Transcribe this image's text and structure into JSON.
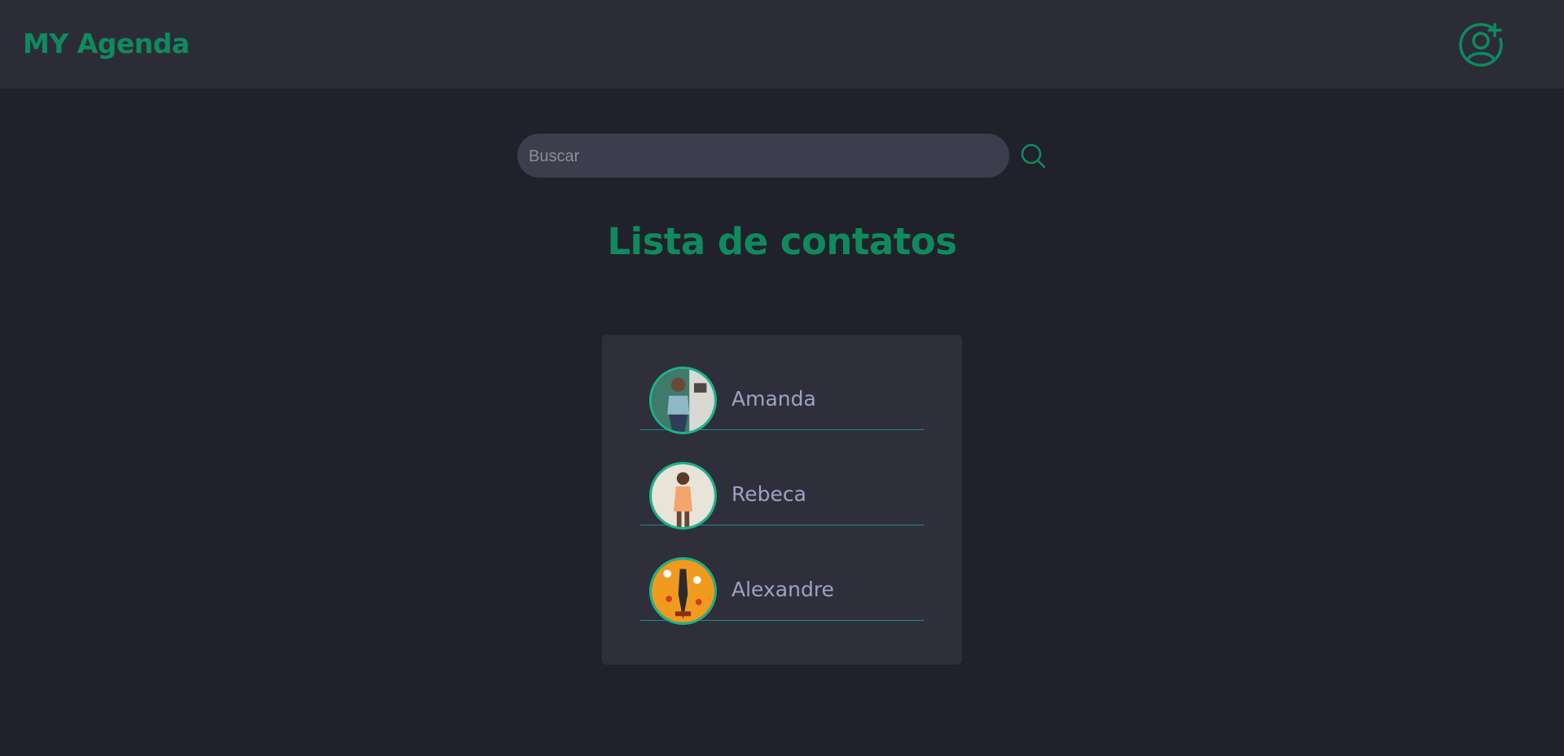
{
  "header": {
    "brand": "MY Agenda",
    "add_contact_icon": "user-plus-icon"
  },
  "search": {
    "placeholder": "Buscar",
    "value": "",
    "icon": "search-icon"
  },
  "main": {
    "title": "Lista de contatos"
  },
  "contacts": [
    {
      "name": "Amanda"
    },
    {
      "name": "Rebeca"
    },
    {
      "name": "Alexandre"
    }
  ],
  "colors": {
    "accent": "#0f8a5f",
    "background": "#21212b",
    "header_bg": "#2c2c37",
    "card_bg": "#2f2f3b",
    "divider": "#1c8f80",
    "name_text": "#9ba3c5"
  }
}
